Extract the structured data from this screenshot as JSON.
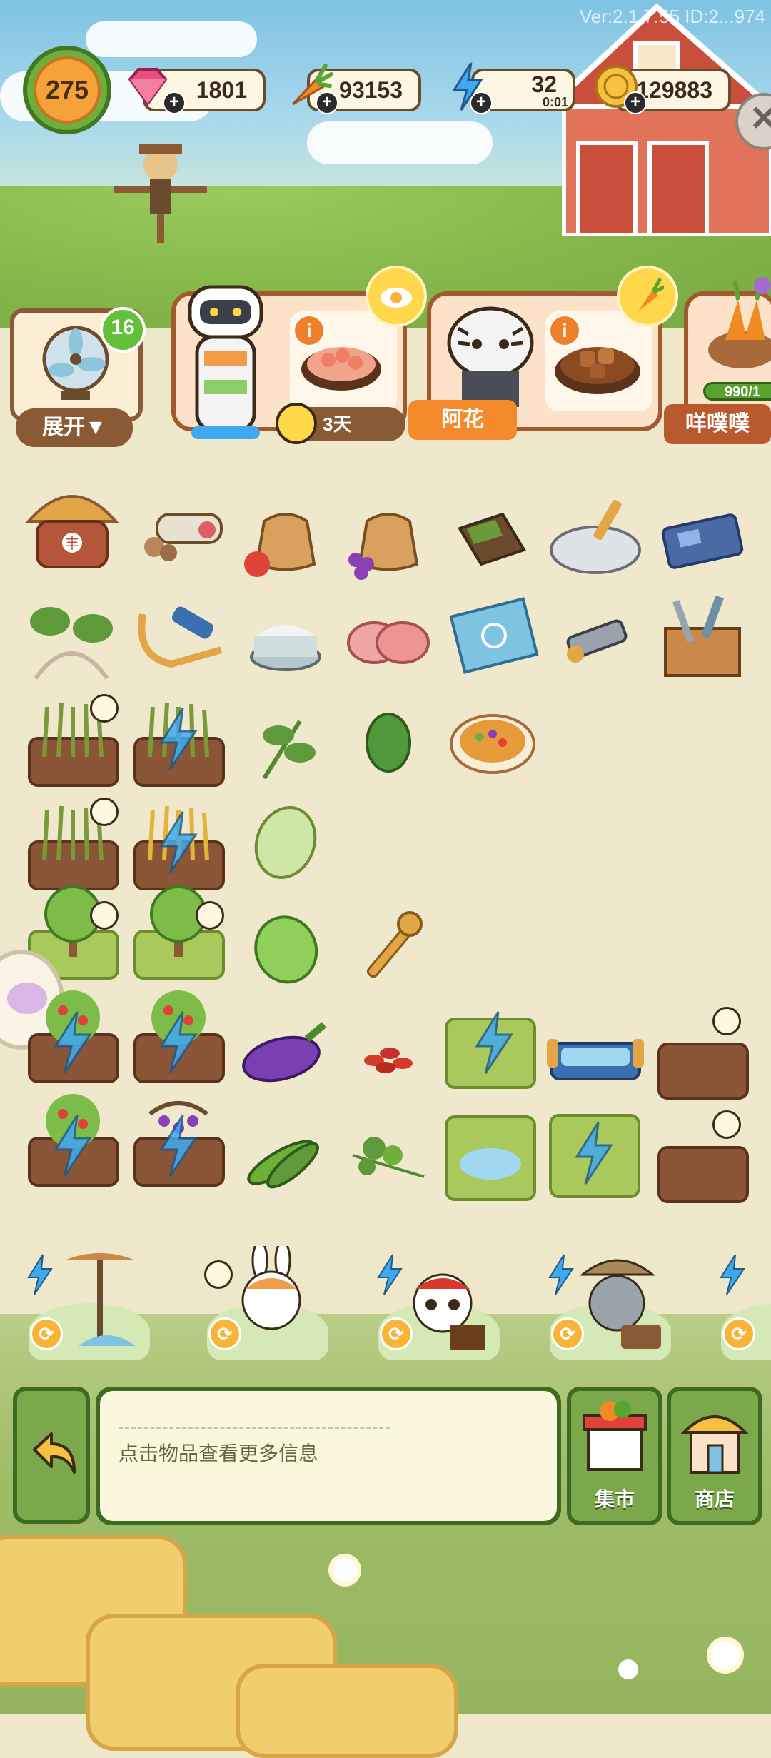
{
  "version": "Ver:2.1.7.55 ID:2...974",
  "level": "275",
  "resources": {
    "gems": "1801",
    "carrots": "93153",
    "energy": "32",
    "energy_timer": "0:01",
    "coins": "129883"
  },
  "orders": {
    "expand_badge": "16",
    "expand_label": "展开▼",
    "order1_time": "3天",
    "order2_name": "阿花",
    "order3_name": "咩噗噗",
    "order3_progress": "990/1",
    "plus_symbol": "+",
    "info_symbol": "i",
    "close_symbol": "✕",
    "swap_symbol": "⟳"
  },
  "bottom": {
    "info_hint": "点击物品查看更多信息",
    "market_label": "集市",
    "shop_label": "商店"
  },
  "colors": {
    "accent_orange": "#f48a2c",
    "board_bg": "#efe8cc",
    "bottom_green": "#7aa84a",
    "bolt_blue": "#3fa9f0"
  }
}
